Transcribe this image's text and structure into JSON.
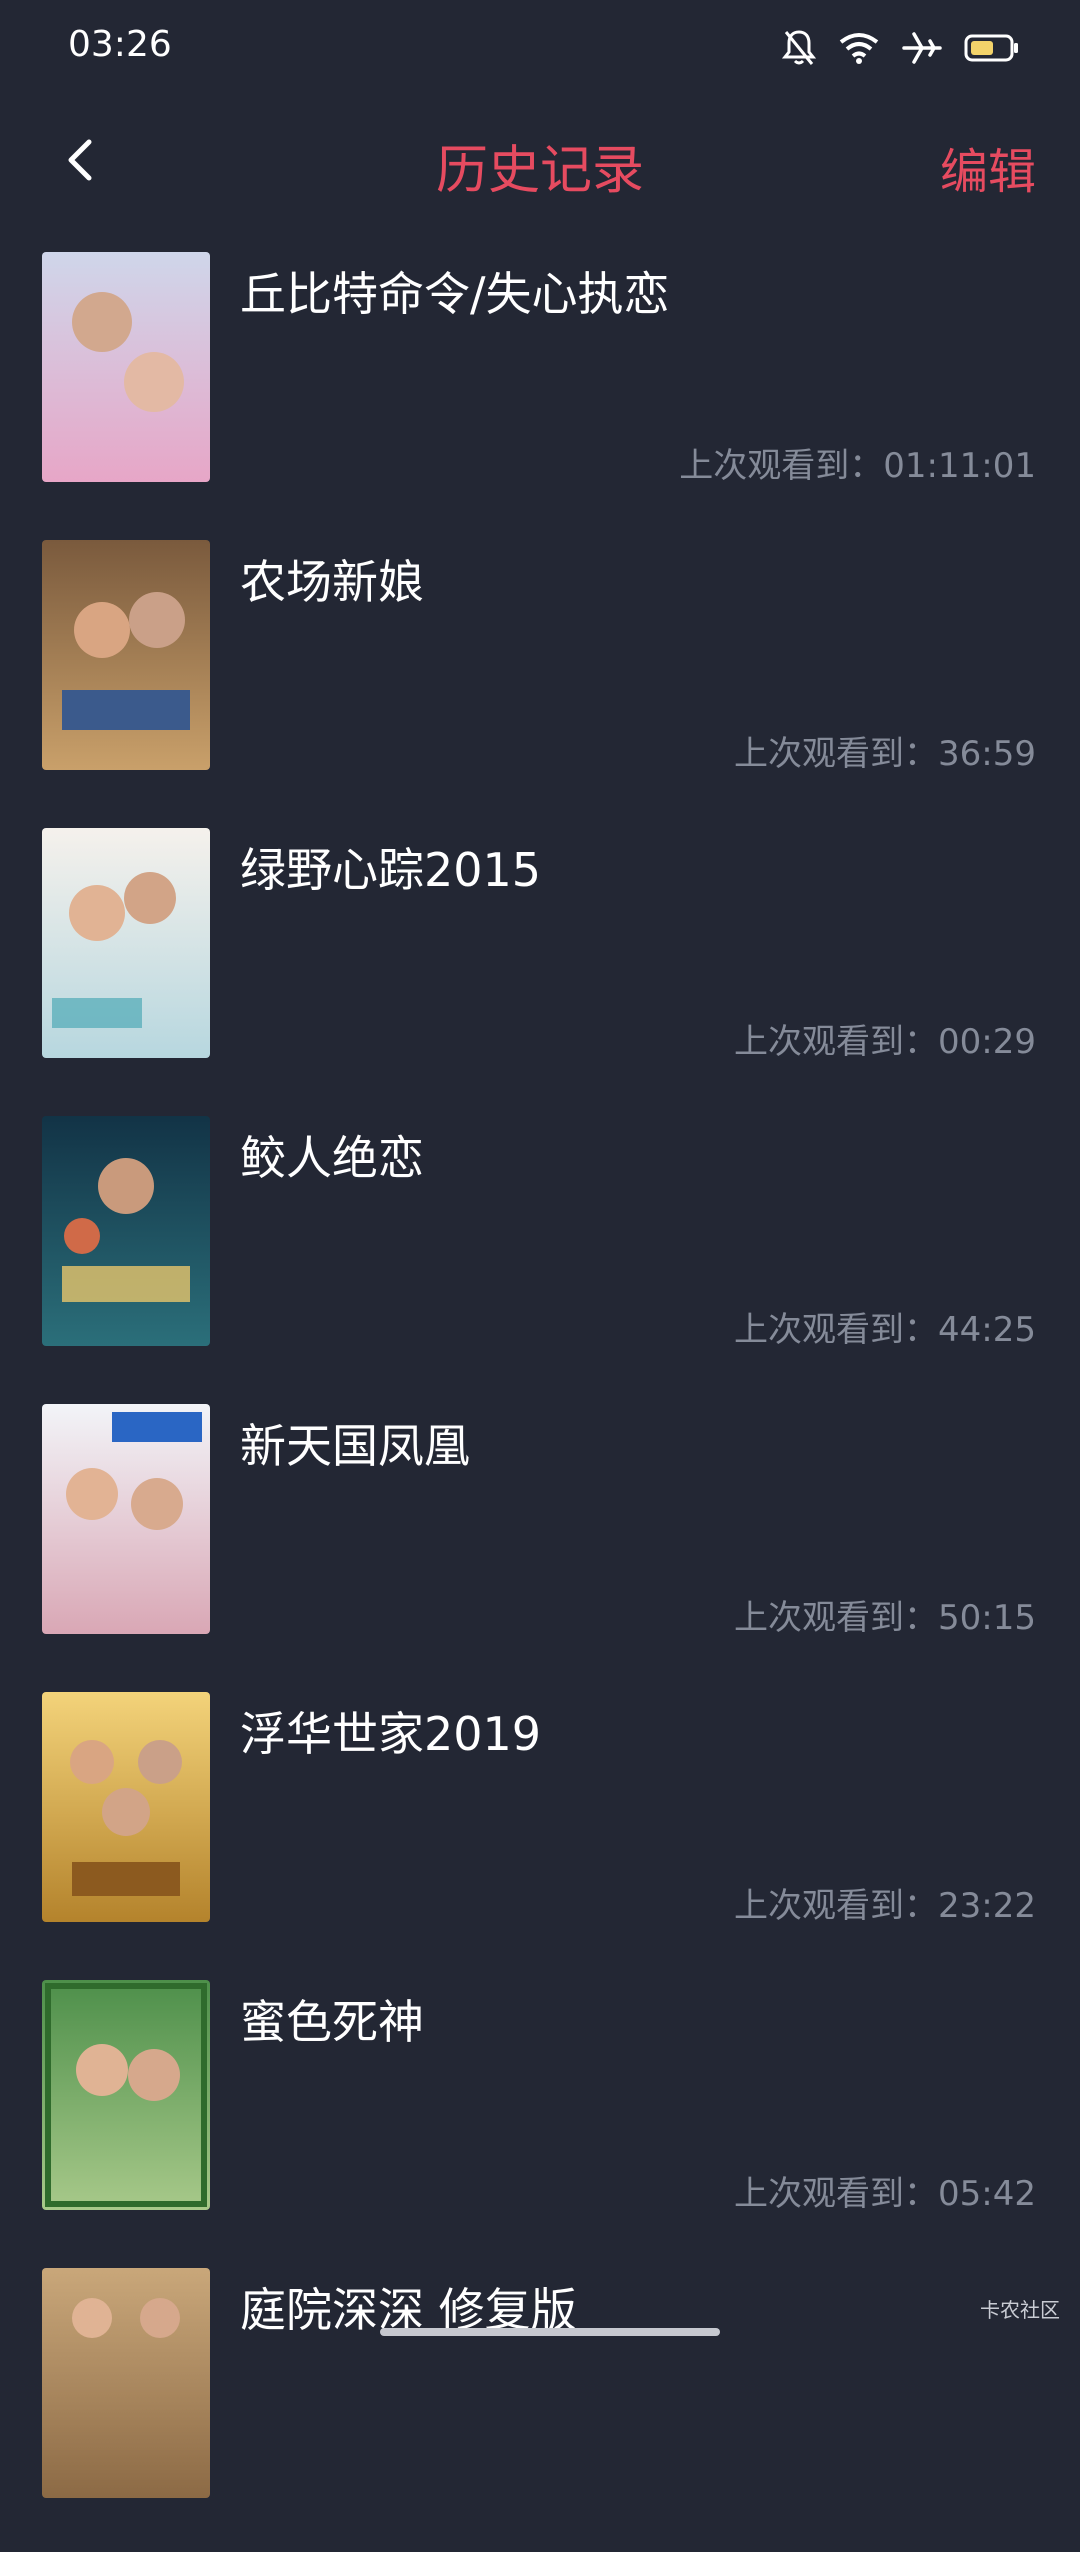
{
  "status_bar": {
    "time": "03:26",
    "icons": [
      "bell-muted-icon",
      "wifi-icon",
      "airplane-icon",
      "battery-icon"
    ],
    "battery_color": "#f3d36a"
  },
  "header": {
    "back_icon": "chevron-left-icon",
    "title": "历史记录",
    "edit_label": "编辑",
    "accent_color": "#e64b60"
  },
  "history": [
    {
      "title": "丘比特命令/失心执恋",
      "progress_label": "上次观看到：01:11:01",
      "poster_colors": [
        "#cfd6ea",
        "#e7a6c7"
      ]
    },
    {
      "title": "农场新娘",
      "progress_label": "上次观看到：36:59",
      "poster_colors": [
        "#7a5a3d",
        "#c9a06a"
      ]
    },
    {
      "title": "绿野心踪2015",
      "progress_label": "上次观看到：00:29",
      "poster_colors": [
        "#f5f1ec",
        "#b7d7df"
      ]
    },
    {
      "title": "鲛人绝恋",
      "progress_label": "上次观看到：44:25",
      "poster_colors": [
        "#123346",
        "#2b6f7a"
      ]
    },
    {
      "title": "新天国凤凰",
      "progress_label": "上次观看到：50:15",
      "poster_colors": [
        "#f2f4f8",
        "#d9a7b5"
      ]
    },
    {
      "title": "浮华世家2019",
      "progress_label": "上次观看到：23:22",
      "poster_colors": [
        "#f3d37a",
        "#b4832c"
      ]
    },
    {
      "title": "蜜色死神",
      "progress_label": "上次观看到：05:42",
      "poster_colors": [
        "#4d8f4a",
        "#a8c98a"
      ]
    },
    {
      "title": "庭院深深 修复版",
      "progress_label": "",
      "poster_colors": [
        "#c9a77a",
        "#8c6a45"
      ]
    }
  ],
  "watermark": "卡农社区"
}
